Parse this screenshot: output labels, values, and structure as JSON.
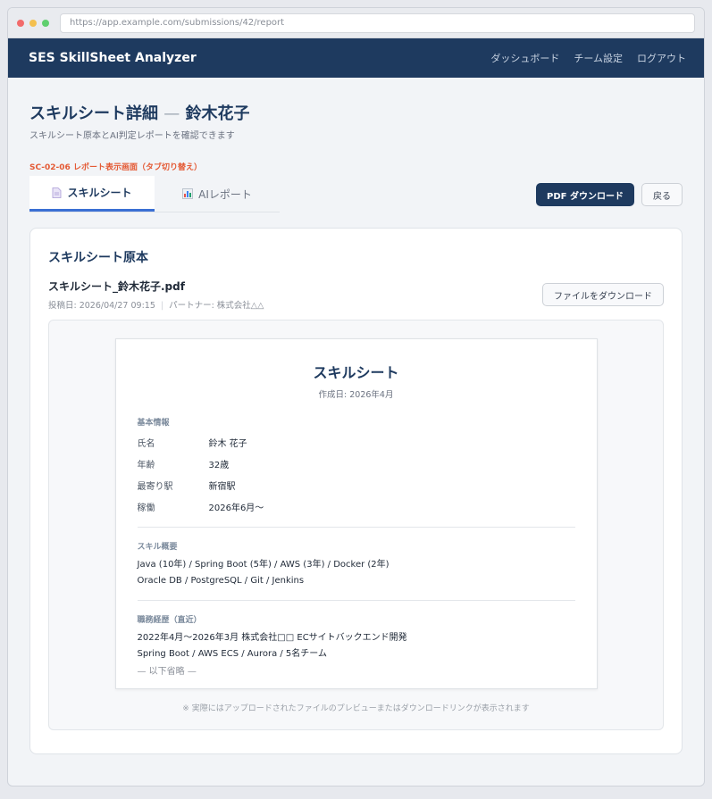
{
  "browser": {
    "url": "https://app.example.com/submissions/42/report"
  },
  "topbar": {
    "brand": "SES SkillSheet Analyzer",
    "nav": [
      "ダッシュボード",
      "チーム設定",
      "ログアウト"
    ]
  },
  "page": {
    "title": "スキルシート詳細",
    "title_sep": "—",
    "title_name": "鈴木花子",
    "subtitle": "スキルシート原本とAI判定レポートを確認できます",
    "screen_id": "SC-02-06 レポート表示画面（タブ切り替え）"
  },
  "tabs": [
    {
      "label": "スキルシート",
      "icon": "document-icon",
      "active": true
    },
    {
      "label": "AIレポート",
      "icon": "bar-chart-icon",
      "active": false
    }
  ],
  "actions": {
    "pdf_download": "PDF ダウンロード",
    "back": "戻る"
  },
  "card": {
    "title": "スキルシート原本",
    "filename": "スキルシート_鈴木花子.pdf",
    "posted": "投稿日: 2026/04/27 09:15",
    "partner": "パートナー: 株式会社△△",
    "download_button": "ファイルをダウンロード"
  },
  "sheet": {
    "title": "スキルシート",
    "date": "作成日: 2026年4月",
    "basic_label": "基本情報",
    "basic": [
      {
        "k": "氏名",
        "v": "鈴木 花子"
      },
      {
        "k": "年齢",
        "v": "32歳"
      },
      {
        "k": "最寄り駅",
        "v": "新宿駅"
      },
      {
        "k": "稼働",
        "v": "2026年6月〜"
      }
    ],
    "skills_label": "スキル概要",
    "skills": [
      "Java (10年) / Spring Boot (5年) / AWS (3年) / Docker (2年)",
      "Oracle DB / PostgreSQL / Git / Jenkins"
    ],
    "history_label": "職務経歴（直近）",
    "history": [
      "2022年4月〜2026年3月 株式会社□□ ECサイトバックエンド開発",
      "Spring Boot / AWS ECS / Aurora / 5名チーム"
    ],
    "omit": "— 以下省略 —"
  },
  "preview_note": "※ 実際にはアップロードされたファイルのプレビューまたはダウンロードリンクが表示されます",
  "colors": {
    "navy": "#1e3a5f",
    "accent": "#3b6fd4",
    "screen_id": "#e45a35"
  }
}
